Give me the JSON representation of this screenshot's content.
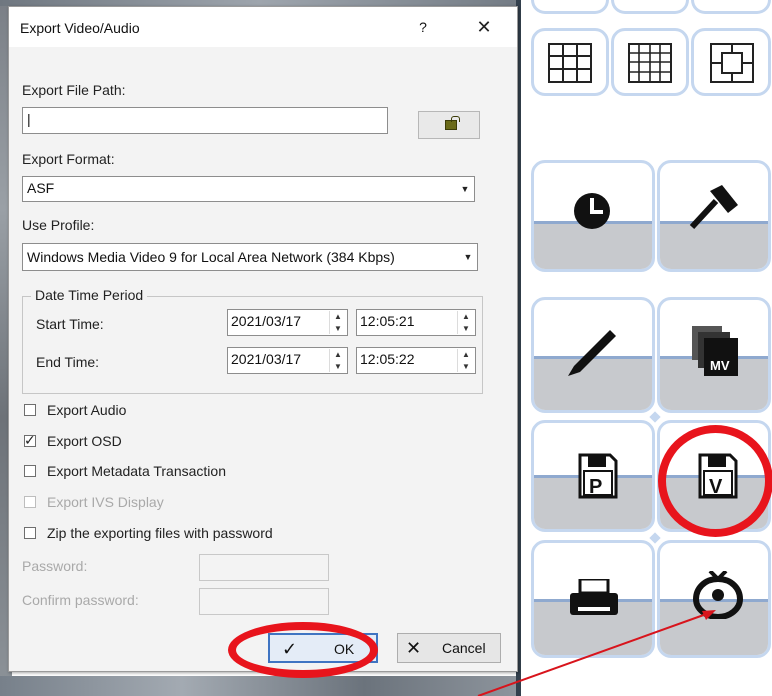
{
  "dialog": {
    "title": "Export Video/Audio",
    "help_label": "?",
    "close_label": "✕",
    "export_file_path": {
      "label": "Export File Path:",
      "value": "|"
    },
    "export_format": {
      "label": "Export Format:",
      "value": "ASF"
    },
    "use_profile": {
      "label": "Use Profile:",
      "value": "Windows Media Video 9 for Local Area Network (384 Kbps)"
    },
    "date_time_period": {
      "title": "Date Time Period",
      "start": {
        "label": "Start Time:",
        "date": "2021/03/17",
        "time": "12:05:21"
      },
      "end": {
        "label": "End Time:",
        "date": "2021/03/17",
        "time": "12:05:22"
      }
    },
    "options": [
      {
        "label": "Export Audio",
        "checked": false,
        "enabled": true
      },
      {
        "label": "Export OSD",
        "checked": true,
        "enabled": true
      },
      {
        "label": "Export Metadata Transaction",
        "checked": false,
        "enabled": true
      },
      {
        "label": "Export IVS Display",
        "checked": false,
        "enabled": false
      },
      {
        "label": "Zip the exporting files with password",
        "checked": false,
        "enabled": true
      }
    ],
    "password": {
      "label": "Password:",
      "value": ""
    },
    "confirm_password": {
      "label": "Confirm password:",
      "value": ""
    },
    "ok_label": "OK",
    "cancel_label": "Cancel"
  },
  "right_panel": {
    "tiles": [
      {
        "name": "clock-icon"
      },
      {
        "name": "hammer-icon"
      },
      {
        "name": "pen-icon"
      },
      {
        "name": "export-mv-icon",
        "badge": "MV"
      },
      {
        "name": "save-picture-icon",
        "letter": "P"
      },
      {
        "name": "save-video-icon",
        "letter": "V"
      },
      {
        "name": "printer-icon"
      },
      {
        "name": "eye-icon"
      }
    ]
  },
  "colors": {
    "highlight_red": "#e8141c",
    "tile_border": "#c5d7ef",
    "ok_border": "#3f74c2"
  }
}
